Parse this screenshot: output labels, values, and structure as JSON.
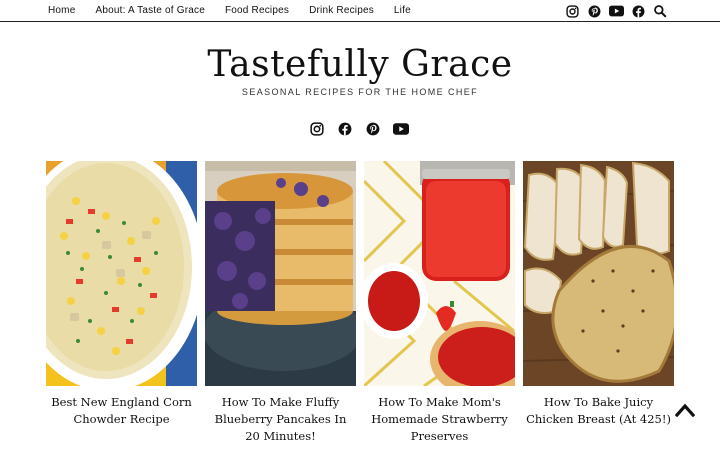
{
  "nav": {
    "items": [
      "Home",
      "About: A Taste of Grace",
      "Food Recipes",
      "Drink Recipes",
      "Life"
    ]
  },
  "icons": {
    "top": [
      "instagram-icon",
      "pinterest-icon",
      "youtube-icon",
      "facebook-icon",
      "search-icon"
    ],
    "social": [
      "instagram-icon",
      "facebook-icon",
      "pinterest-icon",
      "youtube-icon"
    ],
    "back_to_top": "chevron-up-icon"
  },
  "brand": {
    "title": "Tastefully Grace",
    "tagline": "SEASONAL RECIPES FOR THE HOME CHEF"
  },
  "recipes": [
    {
      "title": "Best New England Corn Chowder Recipe"
    },
    {
      "title": "How To Make Fluffy Blueberry Pancakes In 20 Minutes!"
    },
    {
      "title": "How To Make Mom's Homemade Strawberry Preserves"
    },
    {
      "title": "How To Bake Juicy Chicken Breast (At 425!)"
    }
  ],
  "colors": {
    "text": "#111111",
    "background": "#ffffff"
  }
}
